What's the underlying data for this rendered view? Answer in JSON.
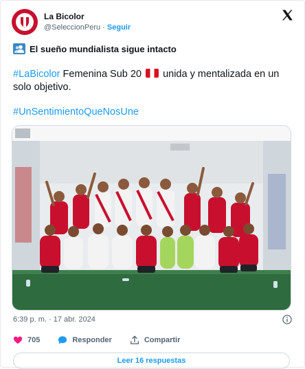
{
  "author": {
    "display_name": "La Bicolor",
    "handle": "@SeleccionPeru",
    "separator": "·",
    "follow_label": "Seguir"
  },
  "post": {
    "headline": "El sueño mundialista sigue intacto",
    "hashtag1": "#LaBicolor",
    "text_part1": "Femenina Sub 20",
    "text_part2": "unida y mentalizada en un solo objetivo.",
    "hashtag2": "#UnSentimientoQueNosUne",
    "image_alt": "Team photo of the Peru women's U-20 squad celebrating in the dressing room",
    "timestamp": "6:39 p. m. · 17 abr. 2024"
  },
  "actions": {
    "likes_count": "705",
    "reply_label": "Responder",
    "share_label": "Compartir",
    "read_replies_label": "Leer 16 respuestas"
  },
  "colors": {
    "accent": "#1d9bf0",
    "like": "#f91880",
    "text": "#0f1419",
    "muted": "#536471",
    "peru_red": "#c8102e"
  },
  "icons": [
    "avatar-logo",
    "x-logo-icon",
    "people-icon",
    "peru-flag-icon",
    "info-icon",
    "heart-icon",
    "reply-bubble-icon",
    "share-icon"
  ]
}
